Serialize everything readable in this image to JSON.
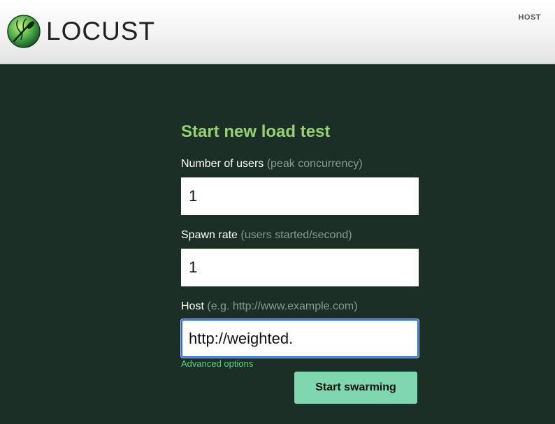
{
  "header": {
    "logo_text": "LOCUST",
    "host_label": "HOST"
  },
  "form": {
    "title": "Start new load test",
    "users": {
      "label": "Number of users",
      "hint": "(peak concurrency)",
      "value": "1"
    },
    "spawn_rate": {
      "label": "Spawn rate",
      "hint": "(users started/second)",
      "value": "1"
    },
    "host": {
      "label": "Host",
      "hint": "(e.g. http://www.example.com)",
      "value": "http://weighted."
    },
    "advanced_link": "Advanced options",
    "submit_label": "Start swarming"
  },
  "colors": {
    "background": "#1b2f27",
    "title": "#97d073",
    "link": "#5fd48e",
    "button": "#7fd7b0",
    "focus_ring": "#2f6de1"
  },
  "icons": {
    "logo": "locust-insect-icon"
  }
}
